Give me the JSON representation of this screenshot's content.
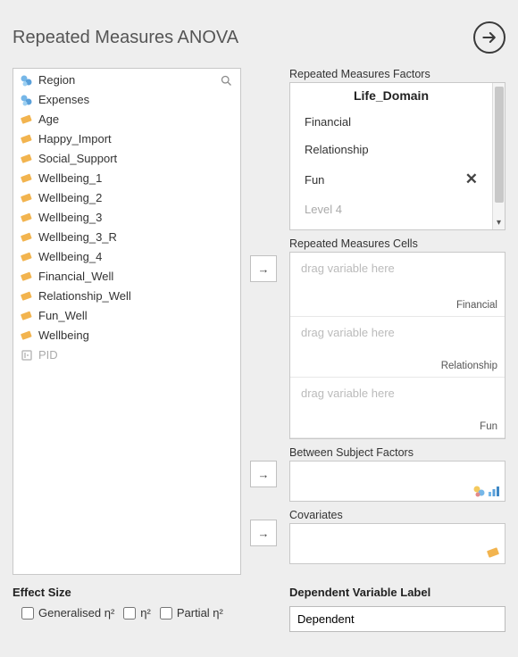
{
  "header": {
    "title": "Repeated Measures ANOVA"
  },
  "variables": [
    {
      "name": "Region",
      "type": "nominal"
    },
    {
      "name": "Expenses",
      "type": "nominal"
    },
    {
      "name": "Age",
      "type": "continuous"
    },
    {
      "name": "Happy_Import",
      "type": "continuous"
    },
    {
      "name": "Social_Support",
      "type": "continuous"
    },
    {
      "name": "Wellbeing_1",
      "type": "continuous"
    },
    {
      "name": "Wellbeing_2",
      "type": "continuous"
    },
    {
      "name": "Wellbeing_3",
      "type": "continuous"
    },
    {
      "name": "Wellbeing_3_R",
      "type": "continuous"
    },
    {
      "name": "Wellbeing_4",
      "type": "continuous"
    },
    {
      "name": "Financial_Well",
      "type": "continuous"
    },
    {
      "name": "Relationship_Well",
      "type": "continuous"
    },
    {
      "name": "Fun_Well",
      "type": "continuous"
    },
    {
      "name": "Wellbeing",
      "type": "continuous"
    },
    {
      "name": "PID",
      "type": "id"
    }
  ],
  "rmFactors": {
    "label": "Repeated Measures Factors",
    "factorName": "Life_Domain",
    "levels": [
      "Financial",
      "Relationship",
      "Fun"
    ],
    "placeholderLevel": "Level 4"
  },
  "rmCells": {
    "label": "Repeated Measures Cells",
    "dragText": "drag variable here",
    "items": [
      "Financial",
      "Relationship",
      "Fun"
    ]
  },
  "between": {
    "label": "Between Subject Factors"
  },
  "covariates": {
    "label": "Covariates"
  },
  "effectSize": {
    "label": "Effect Size",
    "options": [
      "Generalised η²",
      "η²",
      "Partial η²"
    ]
  },
  "depLabel": {
    "label": "Dependent Variable Label",
    "value": "Dependent"
  }
}
